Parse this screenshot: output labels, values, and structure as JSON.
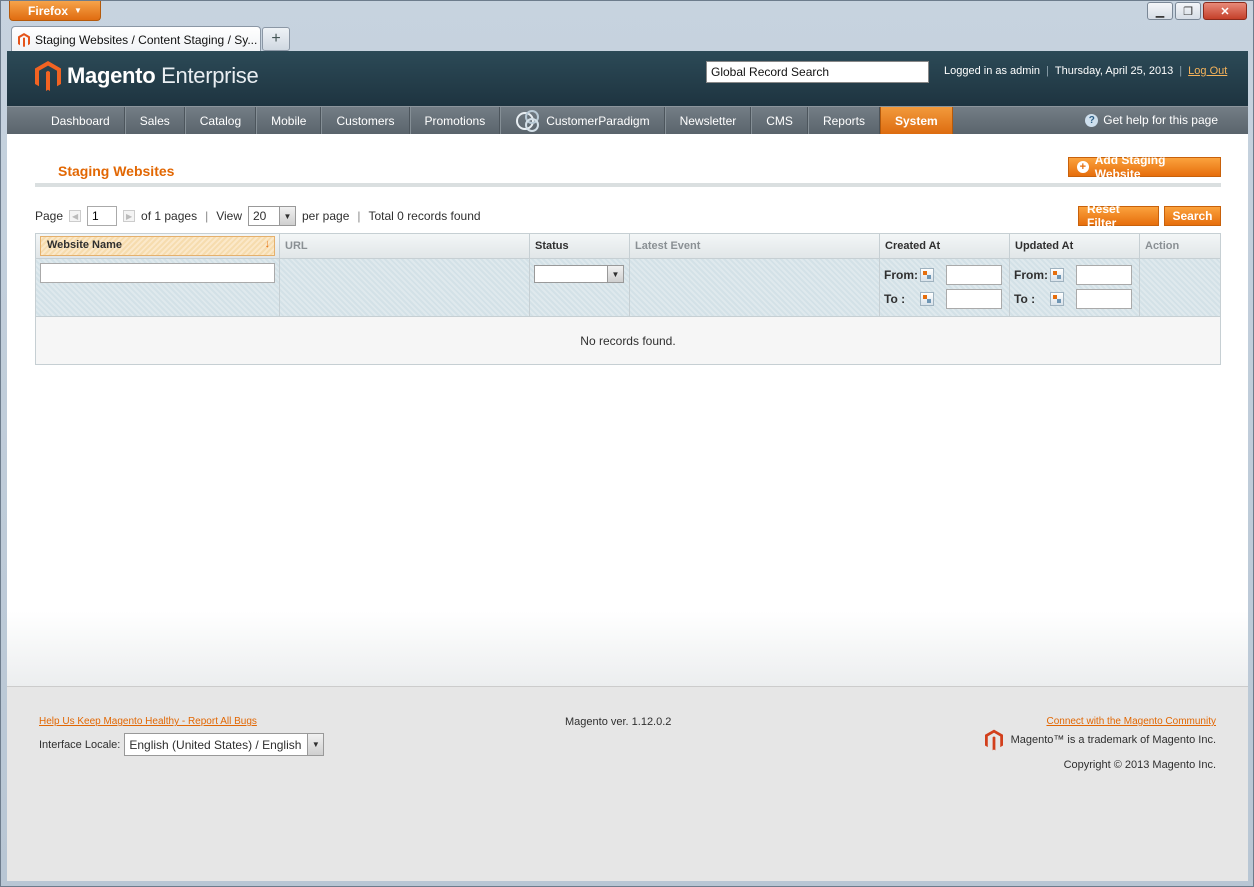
{
  "browser": {
    "menu_button": "Firefox",
    "tab_title": "Staging Websites / Content Staging / Sy..."
  },
  "header": {
    "logo_brand": "Magento",
    "logo_edition": "Enterprise",
    "global_search_value": "Global Record Search",
    "logged_in": "Logged in as admin",
    "date": "Thursday, April 25, 2013",
    "logout": "Log Out"
  },
  "nav": {
    "items": [
      "Dashboard",
      "Sales",
      "Catalog",
      "Mobile",
      "Customers",
      "Promotions",
      "CustomerParadigm",
      "Newsletter",
      "CMS",
      "Reports",
      "System"
    ],
    "active": "System",
    "help": "Get help for this page"
  },
  "page": {
    "title": "Staging Websites",
    "add_button": "Add Staging Website"
  },
  "pager": {
    "page_label": "Page",
    "page_value": "1",
    "of_pages": "of 1 pages",
    "view_label": "View",
    "per_page_value": "20",
    "per_page_label": "per page",
    "total": "Total 0 records found"
  },
  "buttons": {
    "reset_filter": "Reset Filter",
    "search": "Search"
  },
  "grid": {
    "columns": [
      "Website Name",
      "URL",
      "Status",
      "Latest Event",
      "Created At",
      "Updated At",
      "Action"
    ],
    "from_label": "From:",
    "to_label": "To :",
    "empty": "No records found."
  },
  "footer": {
    "report_bugs": "Help Us Keep Magento Healthy - Report All Bugs",
    "locale_label": "Interface Locale:",
    "locale_value": "English (United States) / English",
    "version": "Magento ver. 1.12.0.2",
    "community": "Connect with the Magento Community",
    "trademark": "Magento™ is a trademark of Magento Inc.",
    "copyright": "Copyright © 2013 Magento Inc."
  },
  "colors": {
    "accent": "#e26703",
    "header": "#1e3440",
    "nav": "#5a646c"
  }
}
